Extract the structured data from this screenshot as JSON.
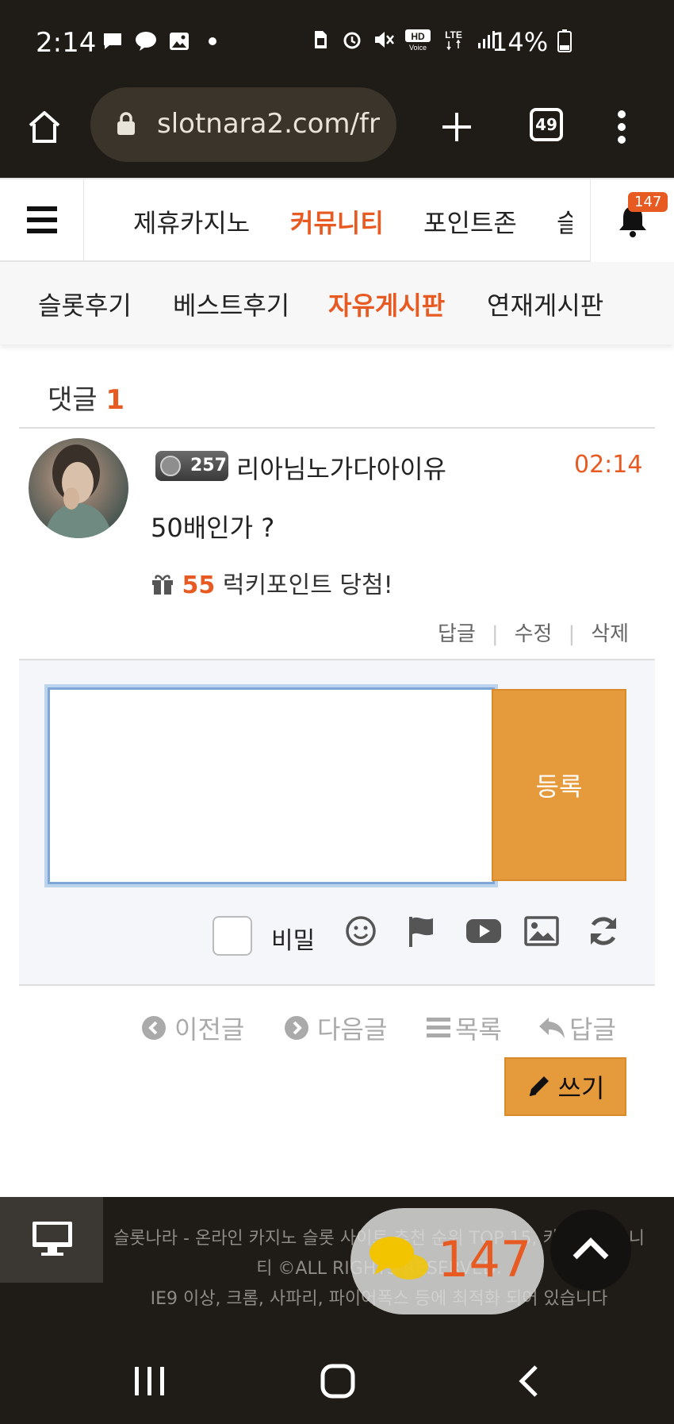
{
  "status_bar": {
    "time": "2:14",
    "battery": "14%",
    "icons": [
      "chat-icon",
      "kakaotalk-icon",
      "gallery-icon",
      "dot-icon",
      "sim-icon",
      "alarm-icon",
      "mute-icon",
      "hd-voice-icon",
      "lte-icon",
      "signal-icon",
      "battery-icon"
    ],
    "hd_label": "HD",
    "voice_label": "Voice",
    "lte_label": "LTE"
  },
  "browser": {
    "url": "slotnara2.com/fr",
    "tab_count": "49"
  },
  "main_nav": {
    "items": [
      "제휴카지노",
      "커뮤니티",
      "포인트존",
      "슬"
    ],
    "active_index": 1,
    "notification_count": "147"
  },
  "sub_nav": {
    "items": [
      "슬롯후기",
      "베스트후기",
      "자유게시판",
      "연재게시판"
    ],
    "active_index": 2
  },
  "comments": {
    "header_label": "댓글",
    "count": "1",
    "items": [
      {
        "level": "257",
        "nickname": "리아님노가다아이유",
        "time": "02:14",
        "body": "50배인가 ?",
        "lucky_points": "55",
        "lucky_text": "럭키포인트 당첨!",
        "actions": [
          "답글",
          "수정",
          "삭제"
        ]
      }
    ]
  },
  "write_box": {
    "submit_label": "등록",
    "secret_label": "비밀",
    "tool_icons": [
      "emoji-icon",
      "flag-icon",
      "youtube-icon",
      "image-icon",
      "refresh-icon"
    ]
  },
  "post_nav": {
    "prev": "이전글",
    "next": "다음글",
    "list": "목록",
    "reply": "답글",
    "write": "쓰기"
  },
  "footer": {
    "line1": "슬롯나라 - 온라인 카지노 슬롯 사이트 추천 순위 TOP 15, 카지노 커뮤니티 ©ALL RIGHTS RESERVED.",
    "line2": "IE9 이상, 크롬, 사파리, 파이어폭스 등에 최적화 되어 있습니다",
    "chat_count": "147"
  },
  "colors": {
    "accent": "#e75b23",
    "button": "#e59a3b",
    "dark_bar": "#1f1b16"
  }
}
